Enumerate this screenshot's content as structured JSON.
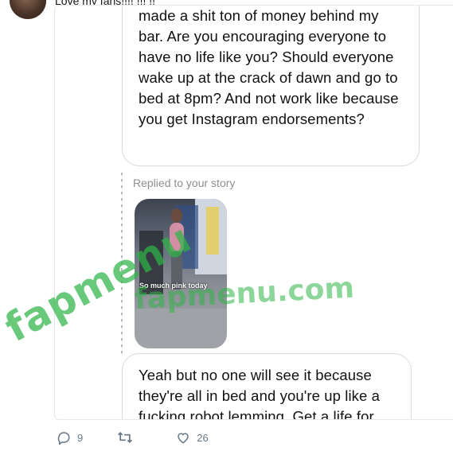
{
  "tweet": {
    "text": "Love my fans!!!! !!! !!",
    "actions": {
      "reply_icon": "reply-icon",
      "reply_count": "9",
      "retweet_icon": "retweet-icon",
      "retweet_count": "",
      "like_icon": "heart-icon",
      "like_count": "26"
    }
  },
  "conversation": {
    "message_top": "made a shit ton of money behind my bar. Are you encouraging everyone to have no life like you? Should everyone wake up at the crack of dawn and go to bed at 8pm? And not work like because you get Instagram endorsements?",
    "replied_label": "Replied to your story",
    "story_caption": "So much pink today",
    "message_bottom": "Yeah but no one will see it because they're all in bed and you're up like a fucking robot lemming. Get a life for"
  },
  "watermark": {
    "text": "fapmenu",
    "small_text": "fapmenu.com"
  },
  "colors": {
    "watermark": "#2eb446",
    "icon_gray": "#657786",
    "bubble_border": "#d9d9de"
  }
}
